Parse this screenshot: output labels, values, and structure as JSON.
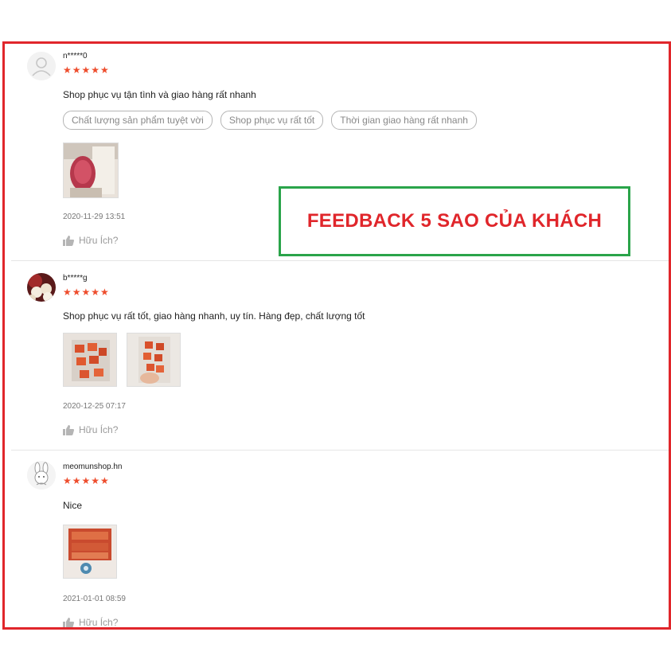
{
  "banner": {
    "text": "FEEDBACK 5 SAO CỦA KHÁCH",
    "text_color": "#e0262b",
    "border_color": "#2aa44a"
  },
  "frame_color": "#e0262b",
  "star_color": "#ee4d2d",
  "reviews": [
    {
      "username": "n*****0",
      "stars": "★★★★★",
      "rating": 5,
      "text": "Shop phục vụ tận tình và giao hàng rất nhanh",
      "tags": [
        "Chất lượng sản phẩm tuyệt vời",
        "Shop phục vụ rất tốt",
        "Thời gian giao hàng rất nhanh"
      ],
      "date": "2020-11-29 13:51",
      "helpful": "Hữu Ích?",
      "avatar": "default-user-icon"
    },
    {
      "username": "b*****g",
      "stars": "★★★★★",
      "rating": 5,
      "text": "Shop phục vụ rất tốt, giao hàng nhanh, uy tín. Hàng đẹp, chất lượng tốt",
      "tags": [],
      "date": "2020-12-25 07:17",
      "helpful": "Hữu Ích?",
      "avatar": "flower-avatar"
    },
    {
      "username": "meomunshop.hn",
      "stars": "★★★★★",
      "rating": 5,
      "text": "Nice",
      "tags": [],
      "date": "2021-01-01 08:59",
      "helpful": "Hữu Ích?",
      "avatar": "bunny-avatar"
    }
  ]
}
